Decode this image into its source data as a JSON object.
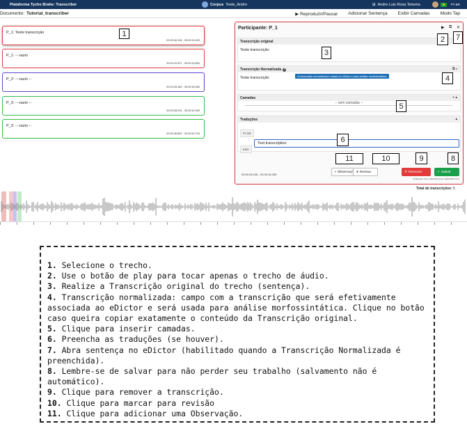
{
  "topbar": {
    "app_title": "Plataforma Tycho Brahe: Transcriber",
    "corpus_label": "Corpus",
    "corpus_name": "Teste_Andre",
    "user_name": "Andre Luiz Rosa Teixeira",
    "language": "PT-BR"
  },
  "document": {
    "label": "Documento:",
    "title": "Tutorial_transcriber",
    "actions": [
      "Reproduzir/Pausar",
      "Adicionar Sentença",
      "Exibir Camadas",
      "Modo Tap"
    ]
  },
  "segments": [
    {
      "label": "P_1: Teste transcrição",
      "time": "00:00:06:106 - 00:00:16:425"
    },
    {
      "label": "P_1: -- vazio",
      "time": "00:00:20:327 - 00:00:34:850"
    },
    {
      "label": "P_2: -- vazio --",
      "time": "00:00:28:189 - 00:00:35:460"
    },
    {
      "label": "P_3: -- vazio --",
      "time": "00:00:38:244 - 00:00:44:390"
    },
    {
      "label": "P_3: -- vazio --",
      "time": "00:00:46:662 - 00:00:50:734"
    }
  ],
  "panel": {
    "title": "Participante: P_1",
    "original_header": "Transcrição original",
    "original_text": "Teste transcrição",
    "normalized_header": "Transcrição Normalizada",
    "normalized_tooltip": "A transcrição normalizada é usada no eDictor e para análise morfossintática.",
    "normalized_text": "Teste transcrição",
    "layers_header": "Camadas",
    "layers_empty": "-- sem camadas --",
    "translations_header": "Traduções",
    "lang_ptbr": "PT-BR",
    "lang_eng": "ENG",
    "translation_value": "Test transcription",
    "btn_obs": "Observações",
    "btn_review": "Revisar",
    "btn_remove": "Remover",
    "btn_save": "Salvar",
    "time": "00:00:06:106 - 00:00:16:425",
    "edit_meta": "Modificação: Andre, 28/01/2025 Envie: 08/dez/2025 14:47"
  },
  "totals": {
    "label": "Total de transcrições:",
    "value": "5"
  },
  "callouts": [
    "1",
    "2",
    "3",
    "4",
    "5",
    "6",
    "7",
    "8",
    "9",
    "10",
    "11"
  ],
  "steps": [
    {
      "n": "1.",
      "text": "Selecione o trecho."
    },
    {
      "n": "2.",
      "text": "Use o botão de play para tocar apenas o trecho de áudio."
    },
    {
      "n": "3.",
      "text": "Realize a Transcrição original do trecho (sentença)."
    },
    {
      "n": "4.",
      "text": "Transcrição normalizada: campo com a transcrição que será efetivamente associada ao eDictor e será usada para análise morfossintática. Clique no botão caso queira copiar exatamente o conteúdo da Transcrição original."
    },
    {
      "n": "5.",
      "text": "Clique para inserir camadas."
    },
    {
      "n": "6.",
      "text": "Preencha as traduções (se houver)."
    },
    {
      "n": "7.",
      "text": "Abra sentença no eDictor (habilitado quando a Transcrição Normalizada é preenchida)."
    },
    {
      "n": "8.",
      "text": "Lembre-se de salvar para não perder seu trabalho (salvamento não é automático)."
    },
    {
      "n": "9.",
      "text": "Clique para remover a transcrição."
    },
    {
      "n": "10.",
      "text": "Clique para marcar para revisão"
    },
    {
      "n": "11.",
      "text": "Clique para adicionar uma Observação."
    }
  ],
  "colors": {
    "topbar": "#15355e",
    "panel_border": "#d9353f",
    "segment_red": "#e03a3a",
    "segment_blue": "#5a45c8",
    "segment_green": "#35bb48",
    "save": "#1aa04a",
    "remove": "#e33b3b"
  }
}
